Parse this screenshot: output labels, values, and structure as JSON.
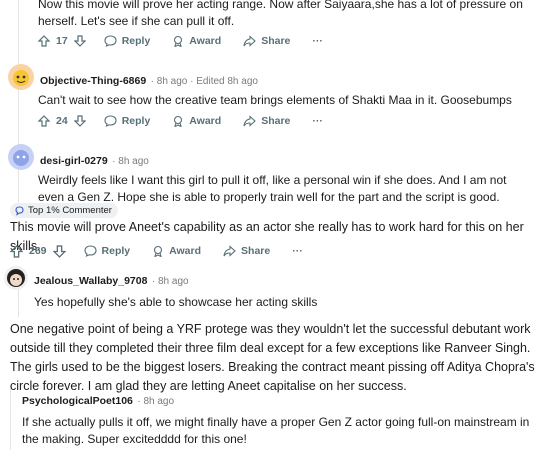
{
  "top_comment": {
    "text": "Now this movie will prove her acting range. Now after Saiyaara,she has a lot of pressure on herself. Let's see if she can pull it off.",
    "votes": "17"
  },
  "comments": [
    {
      "author": "Objective-Thing-6869",
      "time": "· 8h ago · Edited 8h ago",
      "text": "Can't wait to see how the creative team brings elements of Shakti Maa in it. Goosebumps",
      "votes": "24"
    },
    {
      "author": "desi-girl-0279",
      "time": "· 8h ago",
      "text": "Weirdly feels like I want this girl to pull it off, like a personal win if she does. And I am not even a Gen Z. Hope she is able to properly train well for the part and the script is good."
    },
    {
      "author": "Jealous_Wallaby_9708",
      "time": "· 8h ago",
      "text": "Yes hopefully she's able to showcase her acting skills"
    },
    {
      "author": "PsychologicalPoet106",
      "time": "· 8h ago",
      "text": "If she actually pulls it off, we might finally have a proper Gen Z actor going full-on mainstream in the making. Super excitedddd for this one!"
    }
  ],
  "flair": "Top 1% Commenter",
  "reply_text_1": "This movie will prove Aneet's capability as an actor she really has to work hard for this on her skills.",
  "reply_votes_1": "269",
  "reply_text_2": "One negative point of being a YRF protege was they wouldn't let the successful debutant work outside till they completed their three film deal except for a few exceptions like Ranveer Singh. The girls used to be the biggest losers. Breaking the contract meant pissing off Aditya Chopra's circle forever. I am glad they are letting Aneet capitalise on her success.",
  "action_labels": {
    "reply": "Reply",
    "award": "Award",
    "share": "Share",
    "more": "···"
  }
}
